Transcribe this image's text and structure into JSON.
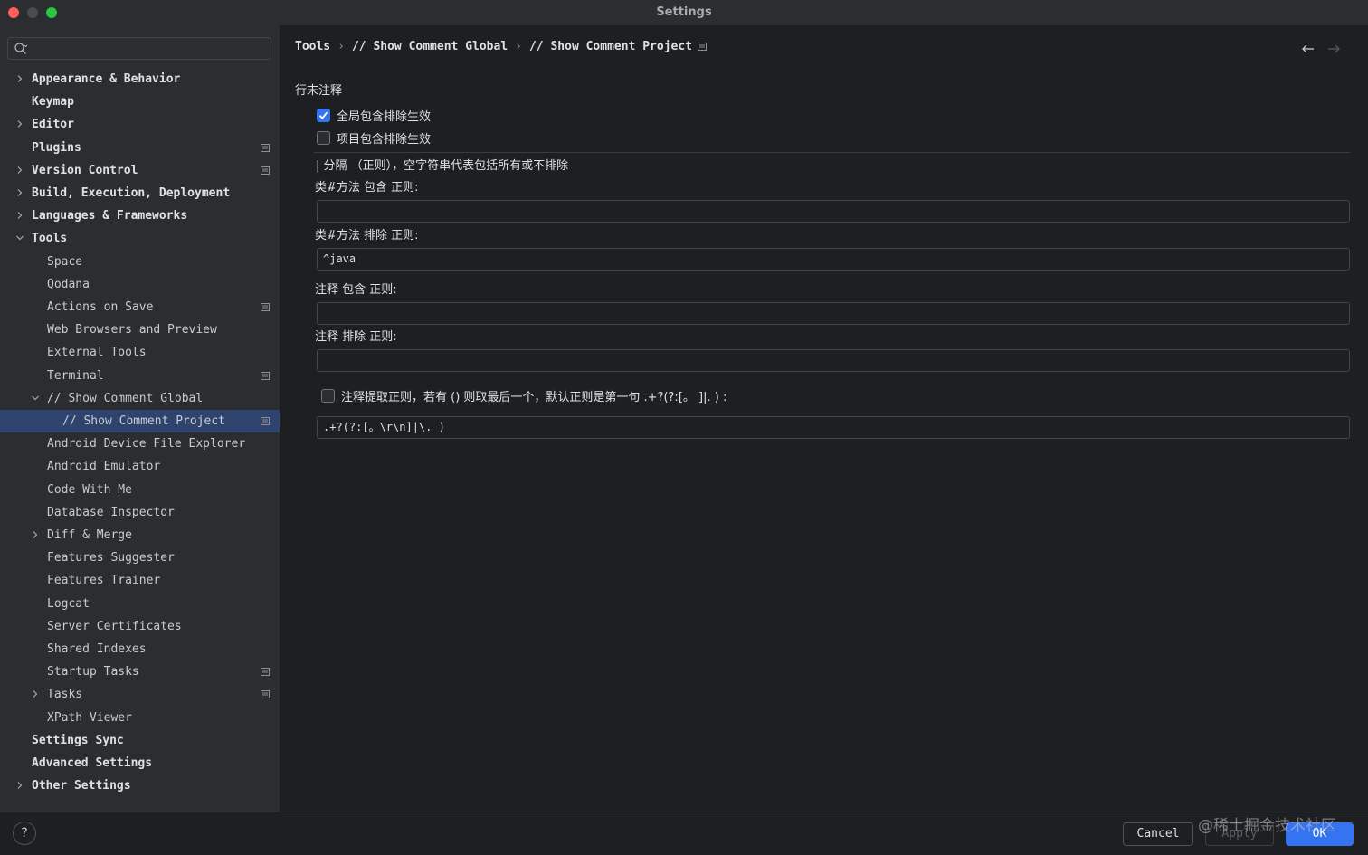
{
  "window": {
    "title": "Settings"
  },
  "search": {
    "placeholder": "",
    "value": ""
  },
  "sidebar": {
    "items": [
      {
        "label": "Appearance & Behavior",
        "level": 0,
        "bold": true,
        "expandable": true,
        "expanded": false,
        "project_icon": false,
        "selected": false
      },
      {
        "label": "Keymap",
        "level": 0,
        "bold": true,
        "expandable": false,
        "expanded": false,
        "project_icon": false,
        "selected": false
      },
      {
        "label": "Editor",
        "level": 0,
        "bold": true,
        "expandable": true,
        "expanded": false,
        "project_icon": false,
        "selected": false
      },
      {
        "label": "Plugins",
        "level": 0,
        "bold": true,
        "expandable": false,
        "expanded": false,
        "project_icon": true,
        "selected": false
      },
      {
        "label": "Version Control",
        "level": 0,
        "bold": true,
        "expandable": true,
        "expanded": false,
        "project_icon": true,
        "selected": false
      },
      {
        "label": "Build, Execution, Deployment",
        "level": 0,
        "bold": true,
        "expandable": true,
        "expanded": false,
        "project_icon": false,
        "selected": false
      },
      {
        "label": "Languages & Frameworks",
        "level": 0,
        "bold": true,
        "expandable": true,
        "expanded": false,
        "project_icon": false,
        "selected": false
      },
      {
        "label": "Tools",
        "level": 0,
        "bold": true,
        "expandable": true,
        "expanded": true,
        "project_icon": false,
        "selected": false
      },
      {
        "label": "Space",
        "level": 1,
        "bold": false,
        "expandable": false,
        "expanded": false,
        "project_icon": false,
        "selected": false
      },
      {
        "label": "Qodana",
        "level": 1,
        "bold": false,
        "expandable": false,
        "expanded": false,
        "project_icon": false,
        "selected": false
      },
      {
        "label": "Actions on Save",
        "level": 1,
        "bold": false,
        "expandable": false,
        "expanded": false,
        "project_icon": true,
        "selected": false
      },
      {
        "label": "Web Browsers and Preview",
        "level": 1,
        "bold": false,
        "expandable": false,
        "expanded": false,
        "project_icon": false,
        "selected": false
      },
      {
        "label": "External Tools",
        "level": 1,
        "bold": false,
        "expandable": false,
        "expanded": false,
        "project_icon": false,
        "selected": false
      },
      {
        "label": "Terminal",
        "level": 1,
        "bold": false,
        "expandable": false,
        "expanded": false,
        "project_icon": true,
        "selected": false
      },
      {
        "label": "// Show Comment Global",
        "level": 1,
        "bold": false,
        "expandable": true,
        "expanded": true,
        "project_icon": false,
        "selected": false
      },
      {
        "label": "// Show Comment Project",
        "level": 2,
        "bold": false,
        "expandable": false,
        "expanded": false,
        "project_icon": true,
        "selected": true
      },
      {
        "label": "Android Device File Explorer",
        "level": 1,
        "bold": false,
        "expandable": false,
        "expanded": false,
        "project_icon": false,
        "selected": false
      },
      {
        "label": "Android Emulator",
        "level": 1,
        "bold": false,
        "expandable": false,
        "expanded": false,
        "project_icon": false,
        "selected": false
      },
      {
        "label": "Code With Me",
        "level": 1,
        "bold": false,
        "expandable": false,
        "expanded": false,
        "project_icon": false,
        "selected": false
      },
      {
        "label": "Database Inspector",
        "level": 1,
        "bold": false,
        "expandable": false,
        "expanded": false,
        "project_icon": false,
        "selected": false
      },
      {
        "label": "Diff & Merge",
        "level": 1,
        "bold": false,
        "expandable": true,
        "expanded": false,
        "project_icon": false,
        "selected": false
      },
      {
        "label": "Features Suggester",
        "level": 1,
        "bold": false,
        "expandable": false,
        "expanded": false,
        "project_icon": false,
        "selected": false
      },
      {
        "label": "Features Trainer",
        "level": 1,
        "bold": false,
        "expandable": false,
        "expanded": false,
        "project_icon": false,
        "selected": false
      },
      {
        "label": "Logcat",
        "level": 1,
        "bold": false,
        "expandable": false,
        "expanded": false,
        "project_icon": false,
        "selected": false
      },
      {
        "label": "Server Certificates",
        "level": 1,
        "bold": false,
        "expandable": false,
        "expanded": false,
        "project_icon": false,
        "selected": false
      },
      {
        "label": "Shared Indexes",
        "level": 1,
        "bold": false,
        "expandable": false,
        "expanded": false,
        "project_icon": false,
        "selected": false
      },
      {
        "label": "Startup Tasks",
        "level": 1,
        "bold": false,
        "expandable": false,
        "expanded": false,
        "project_icon": true,
        "selected": false
      },
      {
        "label": "Tasks",
        "level": 1,
        "bold": false,
        "expandable": true,
        "expanded": false,
        "project_icon": true,
        "selected": false
      },
      {
        "label": "XPath Viewer",
        "level": 1,
        "bold": false,
        "expandable": false,
        "expanded": false,
        "project_icon": false,
        "selected": false
      },
      {
        "label": "Settings Sync",
        "level": 0,
        "bold": true,
        "expandable": false,
        "expanded": false,
        "project_icon": false,
        "selected": false
      },
      {
        "label": "Advanced Settings",
        "level": 0,
        "bold": true,
        "expandable": false,
        "expanded": false,
        "project_icon": false,
        "selected": false
      },
      {
        "label": "Other Settings",
        "level": 0,
        "bold": true,
        "expandable": true,
        "expanded": false,
        "project_icon": false,
        "selected": false
      }
    ]
  },
  "breadcrumb": {
    "items": [
      "Tools",
      "// Show Comment Global",
      "// Show Comment Project"
    ]
  },
  "content": {
    "section_title": "行末注释",
    "global_checkbox": {
      "label": "全局包含排除生效",
      "checked": true
    },
    "project_checkbox": {
      "label": "项目包含排除生效",
      "checked": false
    },
    "hint": "| 分隔 （正则），空字符串代表包括所有或不排除",
    "class_include": {
      "label": "类#方法 包含 正则:",
      "value": ""
    },
    "class_exclude": {
      "label": "类#方法 排除 正则:",
      "value": "^java"
    },
    "doc_include": {
      "label": "注释 包含 正则:",
      "value": ""
    },
    "doc_exclude": {
      "label": "注释 排除 正则:",
      "value": ""
    },
    "doc_regex_checkbox": {
      "label": "注释提取正则，若有 () 则取最后一个，默认正则是第一句 .+?(?:[。  ]|. ) :",
      "checked": false
    },
    "doc_regex": {
      "value": ".+?(?:[。\\r\\n]|\\. )"
    }
  },
  "footer": {
    "help": "?",
    "cancel": "Cancel",
    "apply": "Apply",
    "ok": "OK",
    "watermark": "@稀土掘金技术社区"
  },
  "colors": {
    "accent": "#3574f0",
    "selection": "#2e436e",
    "panel": "#2b2d30",
    "background": "#1e1f22"
  }
}
